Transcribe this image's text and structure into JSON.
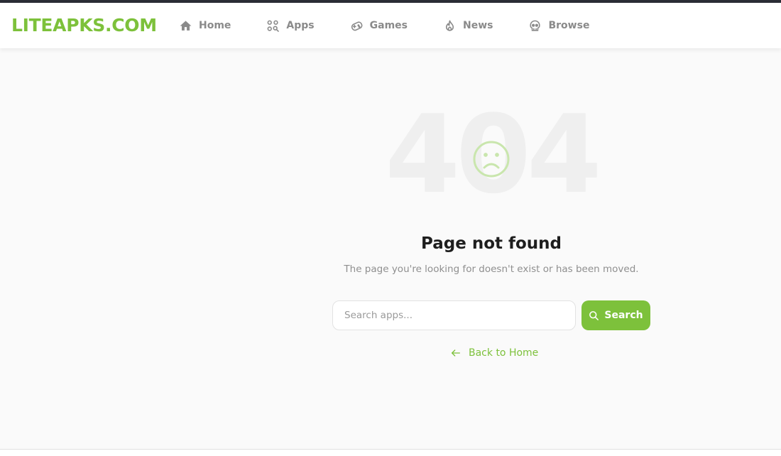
{
  "colors": {
    "brand": "#7dc13b",
    "nav_text": "#8a8a8a",
    "code_text": "#efefef",
    "face": "#c9e6ad"
  },
  "header": {
    "logo": "LITEAPKS.COM",
    "nav": [
      {
        "label": "Home",
        "icon": "home-icon"
      },
      {
        "label": "Apps",
        "icon": "apps-icon"
      },
      {
        "label": "Games",
        "icon": "gamepad-icon"
      },
      {
        "label": "News",
        "icon": "flame-icon"
      },
      {
        "label": "Browse",
        "icon": "skull-icon"
      }
    ]
  },
  "main": {
    "code": "404",
    "face_icon": "sad-face-icon",
    "title": "Page not found",
    "subtitle": "The page you're looking for doesn't exist or has been moved.",
    "search": {
      "placeholder": "Search apps...",
      "value": "",
      "button_label": "Search",
      "button_icon": "search-icon"
    },
    "back_link": {
      "label": "Back to Home",
      "icon": "arrow-left-icon"
    }
  }
}
